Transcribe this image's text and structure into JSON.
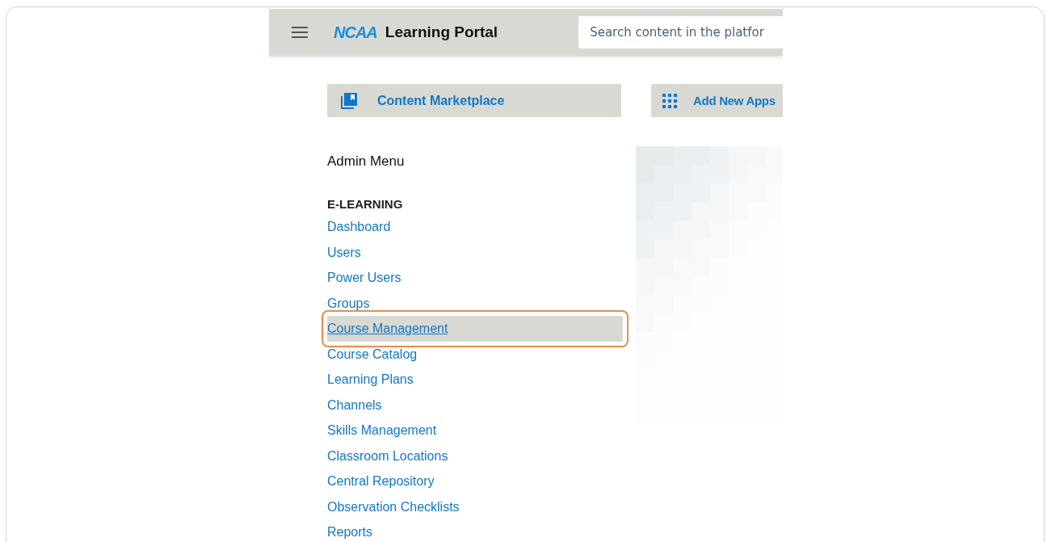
{
  "header": {
    "logo": "NCAA",
    "title": "Learning Portal",
    "search": {
      "placeholder": "Search content in the platfor"
    }
  },
  "actions": [
    {
      "label": "Content Marketplace",
      "kind": "marketplace"
    },
    {
      "label": "Add New Apps",
      "kind": "apps"
    }
  ],
  "admin_menu": {
    "title": "Admin Menu",
    "section": "E-LEARNING",
    "items": [
      {
        "label": "Dashboard",
        "selected": false
      },
      {
        "label": "Users",
        "selected": false
      },
      {
        "label": "Power Users",
        "selected": false
      },
      {
        "label": "Groups",
        "selected": false
      },
      {
        "label": "Course Management",
        "selected": true
      },
      {
        "label": "Course Catalog",
        "selected": false
      },
      {
        "label": "Learning Plans",
        "selected": false
      },
      {
        "label": "Channels",
        "selected": false
      },
      {
        "label": "Skills Management",
        "selected": false
      },
      {
        "label": "Classroom Locations",
        "selected": false
      },
      {
        "label": "Central Repository",
        "selected": false
      },
      {
        "label": "Observation Checklists",
        "selected": false
      },
      {
        "label": "Reports",
        "selected": false
      }
    ]
  }
}
